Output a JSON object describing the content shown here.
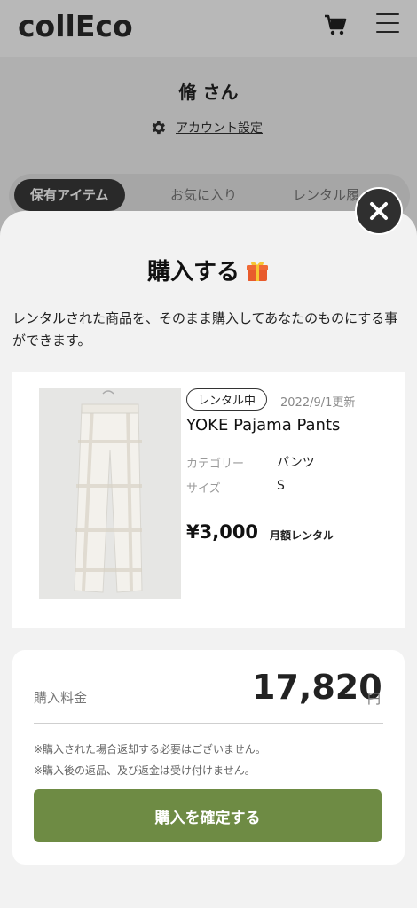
{
  "header": {
    "logo": "collEco",
    "cart_icon": "cart-icon",
    "menu_icon": "hamburger-menu-icon"
  },
  "profile": {
    "user_name": "脩 さん",
    "account_settings_label": "アカウント設定"
  },
  "tabs": [
    {
      "label": "保有アイテム",
      "active": true
    },
    {
      "label": "お気に入り",
      "active": false
    },
    {
      "label": "レンタル履",
      "active": false
    }
  ],
  "modal": {
    "title": "購入する",
    "description": "レンタルされた商品を、そのまま購入してあなたのものにする事ができます。",
    "item": {
      "status_badge": "レンタル中",
      "updated": "2022/9/1更新",
      "name": "YOKE Pajama Pants",
      "category_label": "カテゴリー",
      "category_value": "パンツ",
      "size_label": "サイズ",
      "size_value": "S",
      "price": "¥3,000",
      "price_unit": "月額レンタル"
    },
    "purchase": {
      "fee_label": "購入料金",
      "fee_amount": "17,820",
      "fee_currency": "円",
      "note_1": "※購入された場合返却する必要はございません。",
      "note_2": "※購入後の返品、及び返金は受け付けません。",
      "confirm_label": "購入を確定する"
    }
  },
  "colors": {
    "accent_green": "#6e8b44",
    "dark": "#2f2f2f"
  }
}
